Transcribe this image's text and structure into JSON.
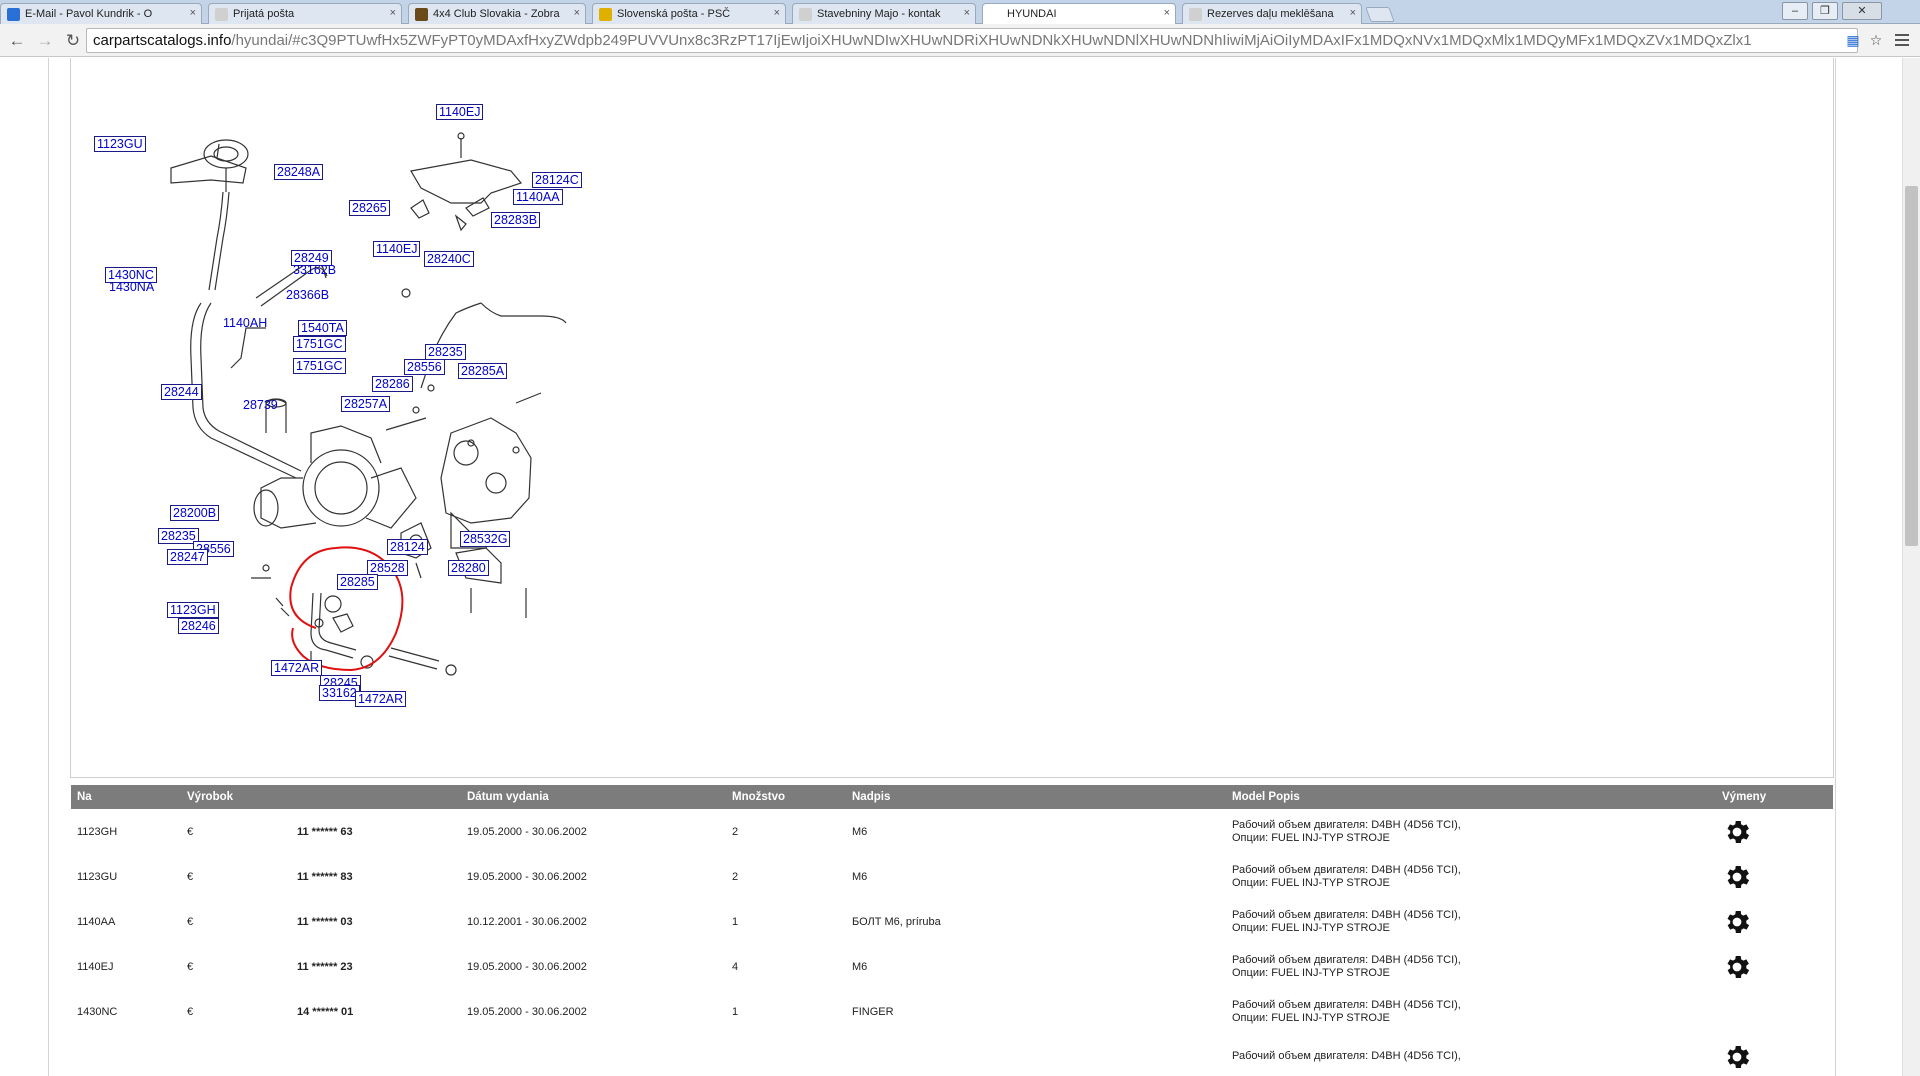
{
  "browser": {
    "tabs": [
      {
        "label": "E-Mail - Pavol Kundrik - O",
        "favicon_color": "#2a6fd6"
      },
      {
        "label": "Prijatá pošta",
        "favicon_color": "#d0d0d0"
      },
      {
        "label": "4x4 Club Slovakia - Zobra",
        "favicon_color": "#6b4a1a"
      },
      {
        "label": "Slovenská pošta - PSČ",
        "favicon_color": "#e0b000"
      },
      {
        "label": "Stavebniny Majo - kontak",
        "favicon_color": "#d0d0d0"
      },
      {
        "label": "HYUNDAI",
        "favicon_color": "#ffffff"
      },
      {
        "label": "Rezerves daļu meklēšana",
        "favicon_color": "#d0d0d0"
      }
    ],
    "active_tab_index": 5,
    "address": {
      "host": "carpartscatalogs.info",
      "path": "/hyundai/#c3Q9PTUwfHx5ZWFyPT0yMDAxfHxyZWdpb249PUVVUnx8c3RzPT17IjEwIjoiXHUwNDIwXHUwNDRiXHUwNDNkXHUwNDNlXHUwNDNhIiwiMjAiOiIyMDAxIFx1MDQxNVx1MDQxMlx1MDQyMFx1MDQxZVx1MDQxZlx1"
    }
  },
  "diagram": {
    "callouts": [
      {
        "code": "1140EJ",
        "boxed": true
      },
      {
        "code": "1123GU",
        "boxed": true
      },
      {
        "code": "28248A",
        "boxed": true
      },
      {
        "code": "28124C",
        "boxed": true
      },
      {
        "code": "1140AA",
        "boxed": true
      },
      {
        "code": "28265",
        "boxed": true
      },
      {
        "code": "28283B",
        "boxed": true
      },
      {
        "code": "1140EJ",
        "boxed": true
      },
      {
        "code": "28240C",
        "boxed": true
      },
      {
        "code": "28249",
        "boxed": true
      },
      {
        "code": "33162B",
        "boxed": false
      },
      {
        "code": "1430NC",
        "boxed": true
      },
      {
        "code": "1430NA",
        "boxed": false
      },
      {
        "code": "28366B",
        "boxed": false
      },
      {
        "code": "1140AH",
        "boxed": false
      },
      {
        "code": "1540TA",
        "boxed": true
      },
      {
        "code": "1751GC",
        "boxed": true
      },
      {
        "code": "28235",
        "boxed": true
      },
      {
        "code": "1751GC",
        "boxed": true
      },
      {
        "code": "28556",
        "boxed": true
      },
      {
        "code": "28285A",
        "boxed": true
      },
      {
        "code": "28286",
        "boxed": true
      },
      {
        "code": "28244",
        "boxed": true
      },
      {
        "code": "28739",
        "boxed": false
      },
      {
        "code": "28257A",
        "boxed": true
      },
      {
        "code": "28200B",
        "boxed": true
      },
      {
        "code": "28235",
        "boxed": true
      },
      {
        "code": "28556",
        "boxed": true
      },
      {
        "code": "28532G",
        "boxed": true
      },
      {
        "code": "28124",
        "boxed": true
      },
      {
        "code": "28247",
        "boxed": true
      },
      {
        "code": "28528",
        "boxed": true
      },
      {
        "code": "28280",
        "boxed": true
      },
      {
        "code": "28285",
        "boxed": true
      },
      {
        "code": "1123GH",
        "boxed": true
      },
      {
        "code": "28246",
        "boxed": true
      },
      {
        "code": "1472AR",
        "boxed": true
      },
      {
        "code": "28245",
        "boxed": true
      },
      {
        "code": "33162",
        "boxed": true
      },
      {
        "code": "1472AR",
        "boxed": true
      }
    ],
    "highlight_color": "#e01010",
    "line_color": "#333333"
  },
  "table": {
    "headers": [
      "Na",
      "Výrobok",
      "",
      "Dátum vydania",
      "Množstvo",
      "Nadpis",
      "Model Popis",
      "Výmeny"
    ],
    "rows": [
      {
        "code": "1123GH",
        "currency": "€",
        "stars": "11 ****** 63",
        "date": "19.05.2000 - 30.06.2002",
        "qty": "2",
        "title": "M6",
        "model1": "Рабочий объем двигателя: D4BH (4D56 TCI),",
        "model2": "Опции: FUEL INJ-TYP STROJE",
        "has_gear": true
      },
      {
        "code": "1123GU",
        "currency": "€",
        "stars": "11 ****** 83",
        "date": "19.05.2000 - 30.06.2002",
        "qty": "2",
        "title": "M6",
        "model1": "Рабочий объем двигателя: D4BH (4D56 TCI),",
        "model2": "Опции: FUEL INJ-TYP STROJE",
        "has_gear": true
      },
      {
        "code": "1140AA",
        "currency": "€",
        "stars": "11 ****** 03",
        "date": "10.12.2001 - 30.06.2002",
        "qty": "1",
        "title": "БОЛТ M6, príruba",
        "model1": "Рабочий объем двигателя: D4BH (4D56 TCI),",
        "model2": "Опции: FUEL INJ-TYP STROJE",
        "has_gear": true
      },
      {
        "code": "1140EJ",
        "currency": "€",
        "stars": "11 ****** 23",
        "date": "19.05.2000 - 30.06.2002",
        "qty": "4",
        "title": "M6",
        "model1": "Рабочий объем двигателя: D4BH (4D56 TCI),",
        "model2": "Опции: FUEL INJ-TYP STROJE",
        "has_gear": true
      },
      {
        "code": "1430NC",
        "currency": "€",
        "stars": "14 ****** 01",
        "date": "19.05.2000 - 30.06.2002",
        "qty": "1",
        "title": "FINGER",
        "model1": "Рабочий объем двигателя: D4BH (4D56 TCI),",
        "model2": "Опции: FUEL INJ-TYP STROJE",
        "has_gear": false
      },
      {
        "code": "",
        "currency": "",
        "stars": "",
        "date": "",
        "qty": "",
        "title": "",
        "model1": "Рабочий объем двигателя: D4BH (4D56 TCI),",
        "model2": "",
        "has_gear": true
      }
    ]
  }
}
